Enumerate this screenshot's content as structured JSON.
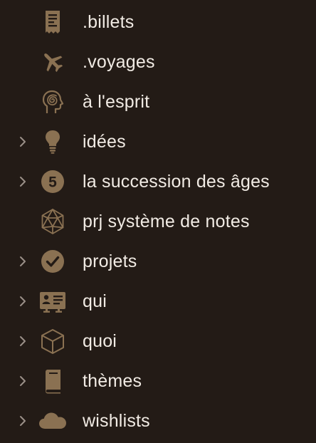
{
  "colors": {
    "background": "#231b16",
    "icon": "#8a7152",
    "icon_text": "#231b16",
    "label": "#f1ebe4",
    "chevron": "#9a9088"
  },
  "items": [
    {
      "label": ".billets",
      "icon": "receipt-icon",
      "expandable": false
    },
    {
      "label": ".voyages",
      "icon": "airplane-icon",
      "expandable": false
    },
    {
      "label": "à l'esprit",
      "icon": "head-spiral-icon",
      "expandable": false
    },
    {
      "label": "idées",
      "icon": "lightbulb-icon",
      "expandable": true
    },
    {
      "label": "la succession des âges",
      "icon": "number-five-icon",
      "icon_text": "5",
      "expandable": true
    },
    {
      "label": "prj système de notes",
      "icon": "icosahedron-icon",
      "expandable": false
    },
    {
      "label": "projets",
      "icon": "checkmark-circle-icon",
      "expandable": true
    },
    {
      "label": "qui",
      "icon": "id-card-icon",
      "expandable": true
    },
    {
      "label": "quoi",
      "icon": "cube-icon",
      "expandable": true
    },
    {
      "label": "thèmes",
      "icon": "book-icon",
      "expandable": true
    },
    {
      "label": "wishlists",
      "icon": "cloud-icon",
      "expandable": true
    }
  ]
}
